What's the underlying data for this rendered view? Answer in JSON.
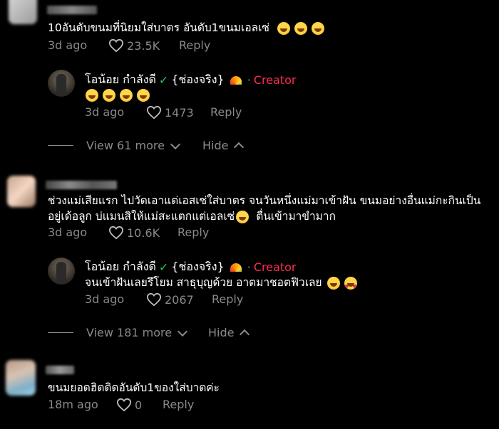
{
  "comments": [
    {
      "text_lines": [
        "10อันดับขนมที่นิยมใส่บาตร อันดับ1ขนมเอลเซ่"
      ],
      "time": "3d ago",
      "likes": "23.5K",
      "reply_label": "Reply"
    },
    {
      "text_lines": [
        "ช่วงแม่เสียแรก ไปวัดเอาแต่เอสเซ่ใส่บาตร จนวันหนึ่งแม่มาเข้าฝัน ขนมอย่างอื่นแม่กะกินเป็น",
        "อยู่เด้อลูก บ่แมนสิให้แม่สะแตกแต่เอลเซ่",
        "ตื่นเข้ามาขำมาก"
      ],
      "time": "3d ago",
      "likes": "10.6K",
      "reply_label": "Reply"
    },
    {
      "text_lines": [
        "ขนมยอดฮิตติดอันดับ1ของใส่บาตค่ะ"
      ],
      "time": "18m ago",
      "likes": "0",
      "reply_label": "Reply"
    }
  ],
  "replies": [
    {
      "author": "โอน้อย กำลังดี",
      "badge": "{ช่องจริง}",
      "creator_label": "Creator",
      "text": "",
      "time": "3d ago",
      "likes": "1473",
      "reply_label": "Reply"
    },
    {
      "author": "โอน้อย กำลังดี",
      "badge": "{ช่องจริง}",
      "creator_label": "Creator",
      "text": "จนเข้าฝันเลยรึโยม สาธุบุญด้วย อาตมาชอตฟิวเลย",
      "time": "3d ago",
      "likes": "2067",
      "reply_label": "Reply"
    }
  ],
  "threads": [
    {
      "view_more": "View 61 more",
      "hide": "Hide"
    },
    {
      "view_more": "View 181 more",
      "hide": "Hide"
    }
  ],
  "colors": {
    "creator": "#fe2c55",
    "meta": "#8a8a8a",
    "check": "#22c55e"
  }
}
